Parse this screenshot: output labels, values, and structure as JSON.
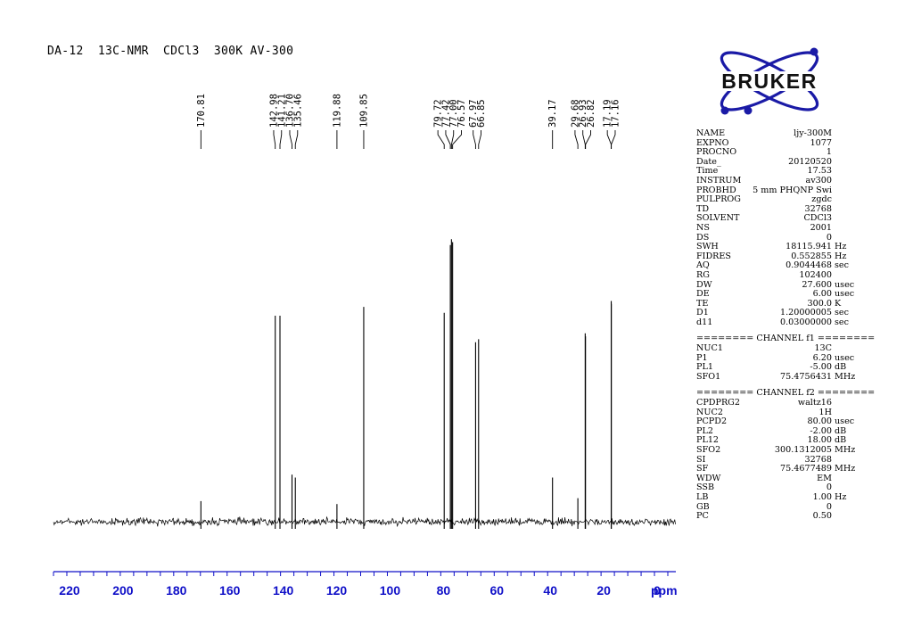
{
  "header": {
    "title": "DA-12  13C-NMR  CDCl3  300K AV-300"
  },
  "logo": {
    "text": "BRUKER",
    "color": "#1a1aa6"
  },
  "colors": {
    "axis": "#1010c8",
    "trace": "#000000"
  },
  "chart_data": {
    "type": "line",
    "title": "DA-12  13C-NMR  CDCl3  300K AV-300",
    "xlabel": "ppm",
    "xlim": [
      226,
      -7
    ],
    "x_reversed": true,
    "xticks": [
      220,
      200,
      180,
      160,
      140,
      120,
      100,
      80,
      60,
      40,
      20,
      0
    ],
    "peak_labels": [
      "170.81",
      "142.98",
      "141.21",
      "136.70",
      "135.46",
      "119.88",
      "109.85",
      "79.72",
      "77.42",
      "77.00",
      "76.57",
      "67.97",
      "66.85",
      "39.17",
      "29.68",
      "26.93",
      "26.82",
      "17.19",
      "17.16"
    ],
    "peaks": [
      {
        "x": 170.81,
        "y": 0.07
      },
      {
        "x": 142.98,
        "y": 0.7
      },
      {
        "x": 141.21,
        "y": 0.7
      },
      {
        "x": 136.7,
        "y": 0.16
      },
      {
        "x": 135.46,
        "y": 0.15
      },
      {
        "x": 119.88,
        "y": 0.06
      },
      {
        "x": 109.85,
        "y": 0.73
      },
      {
        "x": 79.72,
        "y": 0.71
      },
      {
        "x": 77.42,
        "y": 0.94
      },
      {
        "x": 77.0,
        "y": 0.96
      },
      {
        "x": 76.57,
        "y": 0.95
      },
      {
        "x": 67.97,
        "y": 0.61
      },
      {
        "x": 66.85,
        "y": 0.62
      },
      {
        "x": 39.17,
        "y": 0.15
      },
      {
        "x": 29.68,
        "y": 0.08
      },
      {
        "x": 26.93,
        "y": 0.64
      },
      {
        "x": 26.82,
        "y": 0.63
      },
      {
        "x": 17.19,
        "y": 0.75
      },
      {
        "x": 17.16,
        "y": 0.74
      }
    ],
    "noise_level": 0.045
  },
  "params": {
    "block1": [
      {
        "name": "NAME",
        "value": "ljy-300M",
        "unit": ""
      },
      {
        "name": "EXPNO",
        "value": "1077",
        "unit": ""
      },
      {
        "name": "PROCNO",
        "value": "1",
        "unit": ""
      },
      {
        "name": "Date_",
        "value": "20120520",
        "unit": ""
      },
      {
        "name": "Time",
        "value": "17.53",
        "unit": ""
      },
      {
        "name": "INSTRUM",
        "value": "av300",
        "unit": ""
      },
      {
        "name": "PROBHD",
        "value": "5 mm PHQNP Swi",
        "unit": ""
      },
      {
        "name": "PULPROG",
        "value": "zgdc",
        "unit": ""
      },
      {
        "name": "TD",
        "value": "32768",
        "unit": ""
      },
      {
        "name": "SOLVENT",
        "value": "CDCl3",
        "unit": ""
      },
      {
        "name": "NS",
        "value": "2001",
        "unit": ""
      },
      {
        "name": "DS",
        "value": "0",
        "unit": ""
      },
      {
        "name": "SWH",
        "value": "18115.941",
        "unit": "Hz"
      },
      {
        "name": "FIDRES",
        "value": "0.552855",
        "unit": "Hz"
      },
      {
        "name": "AQ",
        "value": "0.9044468",
        "unit": "sec"
      },
      {
        "name": "RG",
        "value": "102400",
        "unit": ""
      },
      {
        "name": "DW",
        "value": "27.600",
        "unit": "usec"
      },
      {
        "name": "DE",
        "value": "6.00",
        "unit": "usec"
      },
      {
        "name": "TE",
        "value": "300.0",
        "unit": "K"
      },
      {
        "name": "D1",
        "value": "1.20000005",
        "unit": "sec"
      },
      {
        "name": "d11",
        "value": "0.03000000",
        "unit": "sec"
      }
    ],
    "channel1_header": "======== CHANNEL f1 ========",
    "block2": [
      {
        "name": "NUC1",
        "value": "13C",
        "unit": ""
      },
      {
        "name": "P1",
        "value": "6.20",
        "unit": "usec"
      },
      {
        "name": "PL1",
        "value": "-5.00",
        "unit": "dB"
      },
      {
        "name": "SFO1",
        "value": "75.4756431",
        "unit": "MHz"
      }
    ],
    "channel2_header": "======== CHANNEL f2 ========",
    "block3": [
      {
        "name": "CPDPRG2",
        "value": "waltz16",
        "unit": ""
      },
      {
        "name": "NUC2",
        "value": "1H",
        "unit": ""
      },
      {
        "name": "PCPD2",
        "value": "80.00",
        "unit": "usec"
      },
      {
        "name": "PL2",
        "value": "-2.00",
        "unit": "dB"
      },
      {
        "name": "PL12",
        "value": "18.00",
        "unit": "dB"
      },
      {
        "name": "SFO2",
        "value": "300.1312005",
        "unit": "MHz"
      },
      {
        "name": "SI",
        "value": "32768",
        "unit": ""
      },
      {
        "name": "SF",
        "value": "75.4677489",
        "unit": "MHz"
      },
      {
        "name": "WDW",
        "value": "EM",
        "unit": ""
      },
      {
        "name": "SSB",
        "value": "0",
        "unit": ""
      },
      {
        "name": "LB",
        "value": "1.00",
        "unit": "Hz"
      },
      {
        "name": "GB",
        "value": "0",
        "unit": ""
      },
      {
        "name": "PC",
        "value": "0.50",
        "unit": ""
      }
    ]
  }
}
